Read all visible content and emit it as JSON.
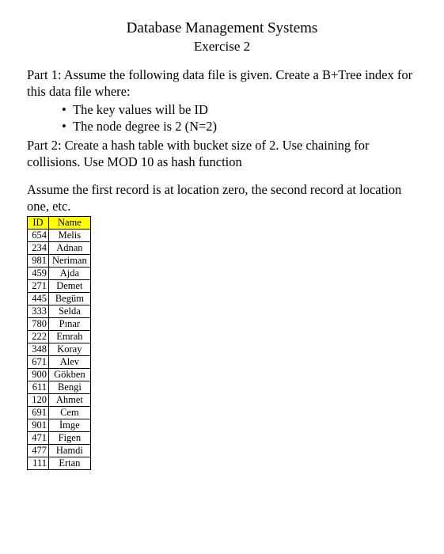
{
  "header": {
    "title": "Database Management Systems",
    "subtitle": "Exercise 2"
  },
  "part1": {
    "intro": "Part 1: Assume the following data file is given. Create a B+Tree index for this data file where:",
    "bullets": [
      "The key values will be ID",
      "The node degree is 2 (N=2)"
    ]
  },
  "part2": {
    "text": "Part 2: Create a hash table with bucket size of 2. Use chaining for collisions. Use MOD 10 as hash function"
  },
  "assumption": "Assume the first record is at location zero, the second record at location one, etc.",
  "table": {
    "headers": {
      "id": "ID",
      "name": "Name"
    },
    "rows": [
      {
        "id": "654",
        "name": "Melis"
      },
      {
        "id": "234",
        "name": "Adnan"
      },
      {
        "id": "981",
        "name": "Neriman"
      },
      {
        "id": "459",
        "name": "Ajda"
      },
      {
        "id": "271",
        "name": "Demet"
      },
      {
        "id": "445",
        "name": "Begüm"
      },
      {
        "id": "333",
        "name": "Selda"
      },
      {
        "id": "780",
        "name": "Pınar"
      },
      {
        "id": "222",
        "name": "Emrah"
      },
      {
        "id": "348",
        "name": "Koray"
      },
      {
        "id": "671",
        "name": "Alev"
      },
      {
        "id": "900",
        "name": "Gökben"
      },
      {
        "id": "611",
        "name": "Bengi"
      },
      {
        "id": "120",
        "name": "Ahmet"
      },
      {
        "id": "691",
        "name": "Cem"
      },
      {
        "id": "901",
        "name": "İmge"
      },
      {
        "id": "471",
        "name": "Figen"
      },
      {
        "id": "477",
        "name": "Hamdi"
      },
      {
        "id": "111",
        "name": "Ertan"
      }
    ]
  }
}
